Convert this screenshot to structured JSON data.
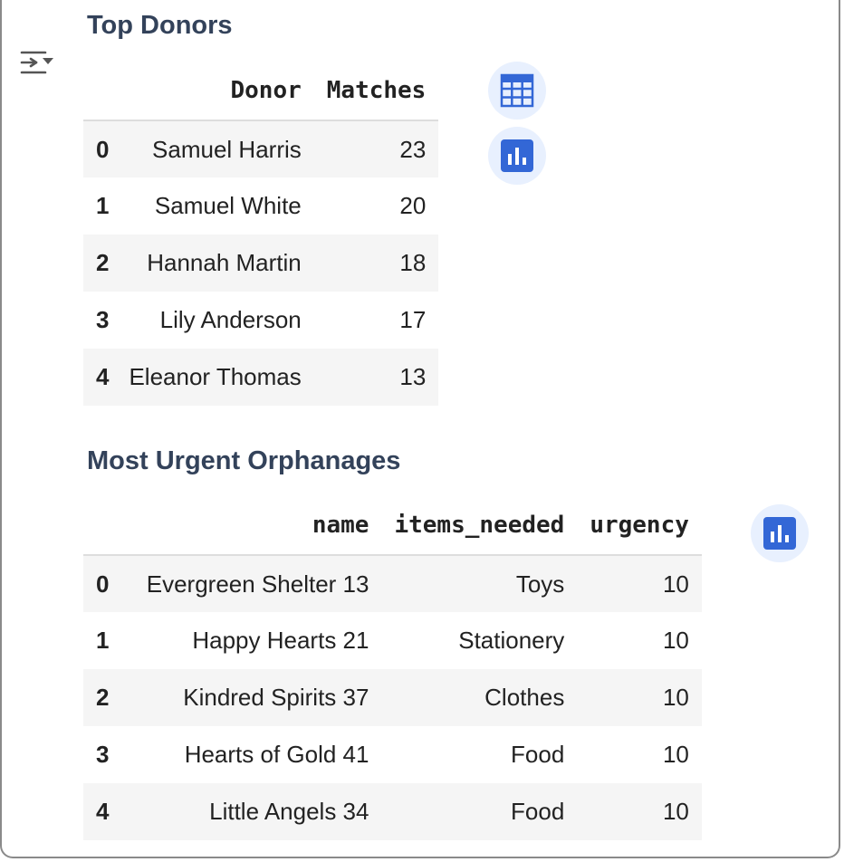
{
  "sections": {
    "donors": {
      "title": "Top Donors",
      "columns": [
        "Donor",
        "Matches"
      ],
      "rows": [
        {
          "index": "0",
          "donor": "Samuel Harris",
          "matches": "23"
        },
        {
          "index": "1",
          "donor": "Samuel White",
          "matches": "20"
        },
        {
          "index": "2",
          "donor": "Hannah Martin",
          "matches": "18"
        },
        {
          "index": "3",
          "donor": "Lily Anderson",
          "matches": "17"
        },
        {
          "index": "4",
          "donor": "Eleanor Thomas",
          "matches": "13"
        }
      ]
    },
    "orphanages": {
      "title": "Most Urgent Orphanages",
      "columns": [
        "name",
        "items_needed",
        "urgency"
      ],
      "rows": [
        {
          "index": "0",
          "name": "Evergreen Shelter 13",
          "items_needed": "Toys",
          "urgency": "10"
        },
        {
          "index": "1",
          "name": "Happy Hearts 21",
          "items_needed": "Stationery",
          "urgency": "10"
        },
        {
          "index": "2",
          "name": "Kindred Spirits 37",
          "items_needed": "Clothes",
          "urgency": "10"
        },
        {
          "index": "3",
          "name": "Hearts of Gold 41",
          "items_needed": "Food",
          "urgency": "10"
        },
        {
          "index": "4",
          "name": "Little Angels 34",
          "items_needed": "Food",
          "urgency": "10"
        }
      ]
    }
  },
  "icons": {
    "output_toggle": "output-toggle-icon",
    "table_view": "table-grid-icon",
    "chart": "bar-chart-icon"
  },
  "colors": {
    "title": "#33425a",
    "button_bg": "#e8f0fe",
    "icon_blue": "#3367d6",
    "row_stripe": "#f5f5f5"
  }
}
